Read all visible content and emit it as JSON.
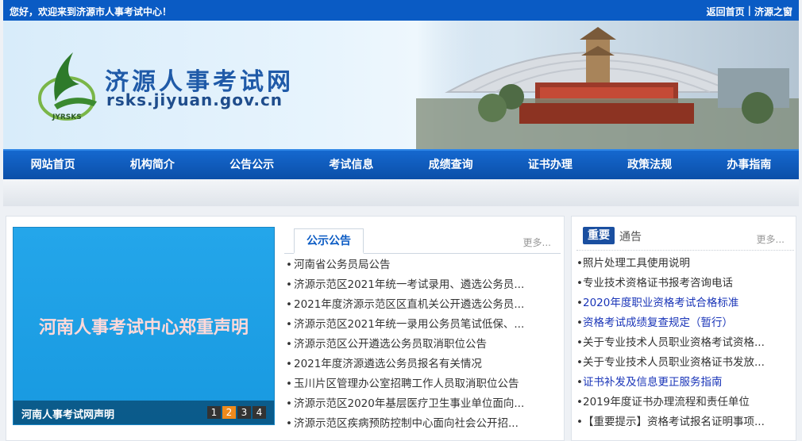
{
  "topbar": {
    "welcome": "您好，欢迎来到济源市人事考试中心！",
    "home_link": "返回首页",
    "separator": "|",
    "jiyuan_link": "济源之窗"
  },
  "banner": {
    "logo_text": "JYRSKS",
    "site_name": "济源人事考试网",
    "site_domain": "rsks.jiyuan.gov.cn"
  },
  "nav": {
    "items": [
      {
        "label": "网站首页"
      },
      {
        "label": "机构简介"
      },
      {
        "label": "公告公示"
      },
      {
        "label": "考试信息"
      },
      {
        "label": "成绩查询"
      },
      {
        "label": "证书办理"
      },
      {
        "label": "政策法规"
      },
      {
        "label": "办事指南"
      }
    ]
  },
  "slider": {
    "slide_text": "河南人事考试中心郑重声明",
    "caption": "河南人事考试网声明",
    "pages": [
      "1",
      "2",
      "3",
      "4"
    ],
    "active_page": "2",
    "bg_color": "#1ea0e6"
  },
  "notice": {
    "tab_label": "公示公告",
    "more": "更多...",
    "items": [
      "河南省公务员局公告",
      "济源示范区2021年统一考试录用、遴选公务员...",
      "2021年度济源示范区区直机关公开遴选公务员...",
      "济源示范区2021年统一录用公务员笔试低保、...",
      "济源示范区公开遴选公务员取消职位公告",
      "2021年度济源遴选公务员报名有关情况",
      "玉川片区管理办公室招聘工作人员取消职位公告",
      "济源示范区2020年基层医疗卫生事业单位面向...",
      "济源示范区疾病预防控制中心面向社会公开招..."
    ]
  },
  "important": {
    "badge": "重要",
    "title_rest": "通告",
    "more": "更多...",
    "items": [
      {
        "text": "照片处理工具使用说明",
        "highlight": false
      },
      {
        "text": "专业技术资格证书报考咨询电话",
        "highlight": false
      },
      {
        "text": "2020年度职业资格考试合格标准",
        "highlight": true
      },
      {
        "text": "资格考试成绩复查规定（暂行）",
        "highlight": true
      },
      {
        "text": "关于专业技术人员职业资格考试资格...",
        "highlight": false
      },
      {
        "text": "关于专业技术人员职业资格证书发放...",
        "highlight": false
      },
      {
        "text": "证书补发及信息更正服务指南",
        "highlight": true
      },
      {
        "text": "2019年度证书办理流程和责任单位",
        "highlight": false
      },
      {
        "text": "【重要提示】资格考试报名证明事项...",
        "highlight": false
      }
    ]
  },
  "colors": {
    "brand_blue": "#0a5bc4",
    "link_blue": "#1a35b8",
    "pager_active": "#f08a1c"
  }
}
